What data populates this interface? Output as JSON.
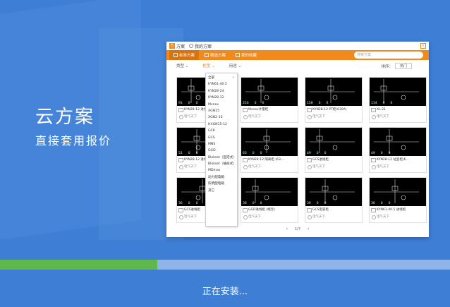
{
  "hero": {
    "title": "云方案",
    "subtitle": "直接套用报价"
  },
  "window": {
    "titlebar": {
      "tabs": [
        {
          "label": "方案",
          "logo": "方案"
        },
        {
          "label": "我的方案"
        }
      ]
    },
    "nav": {
      "tabs": [
        {
          "label": "标准方案",
          "active": true
        },
        {
          "label": "精选方案"
        },
        {
          "label": "我的收藏"
        }
      ],
      "search_placeholder": "搜索方案"
    },
    "filters": [
      {
        "label": "类型"
      },
      {
        "label": "柜型",
        "active": true
      },
      {
        "label": "用途"
      }
    ],
    "sort": {
      "label": "排序：",
      "value": "热门"
    },
    "dropdown": [
      "全部",
      "KYN61-40.5",
      "KYN28-24",
      "KYN28-12",
      "Mvnex",
      "XGN15",
      "XGN2-10",
      "HXGN15-12",
      "GCK",
      "GCS",
      "MNS",
      "GGD",
      "Blokset（固定式）",
      "Blokset（抽屉式）",
      "MDmax",
      "动力配电箱",
      "照明配电箱",
      "其它"
    ],
    "cards": [
      {
        "stats": [
          "91",
          "0",
          "0"
        ],
        "name": "KYN28-12 进线柜",
        "author": "电气天下"
      },
      {
        "stats": [
          "250",
          "0",
          "0"
        ],
        "name": "Mvnex计量柜",
        "author": "电气天下"
      },
      {
        "stats": [
          "158",
          "0",
          "0"
        ],
        "name": "KYN28-12 PT柜(630A)",
        "author": "电气天下"
      },
      {
        "stats": [
          "114",
          "0",
          "0"
        ],
        "name": "XL-21",
        "author": "电气天下"
      },
      {
        "stats": [
          "51",
          "0",
          "0"
        ],
        "name": "KYN28-12 进线柜",
        "author": "电气天下"
      },
      {
        "stats": [
          "63",
          "0",
          "0"
        ],
        "name": "KYN28-12 隔离柜 (63-...",
        "author": "电气天下"
      },
      {
        "stats": [
          "49",
          "0",
          "0"
        ],
        "name": "GCS进线柜",
        "author": "电气天下"
      },
      {
        "stats": [
          "49",
          "0",
          "0"
        ],
        "name": "KYN28-12 站变柜(6...",
        "author": "电气天下"
      },
      {
        "stats": [
          "36",
          "0",
          "0"
        ],
        "name": "GCS进线柜",
        "author": "电气天下"
      },
      {
        "stats": [
          "36",
          "0",
          "0"
        ],
        "name": "GGD进线柜 (端元)",
        "author": "电气天下"
      },
      {
        "stats": [
          "39",
          "0",
          "0"
        ],
        "name": "GCS电容柜",
        "author": "电气天下"
      },
      {
        "stats": [
          "36",
          "0",
          "0"
        ],
        "name": "KYN61-40.5 进线柜",
        "author": "电气天下"
      }
    ],
    "pager": {
      "prev": "‹",
      "label": "1/7",
      "next": "›"
    }
  },
  "install": {
    "status": "正在安装...",
    "progress": 0.35
  },
  "colors": {
    "accent": "#f08a1c",
    "background": "#3e7ed4",
    "progress": "#5fb84a"
  }
}
